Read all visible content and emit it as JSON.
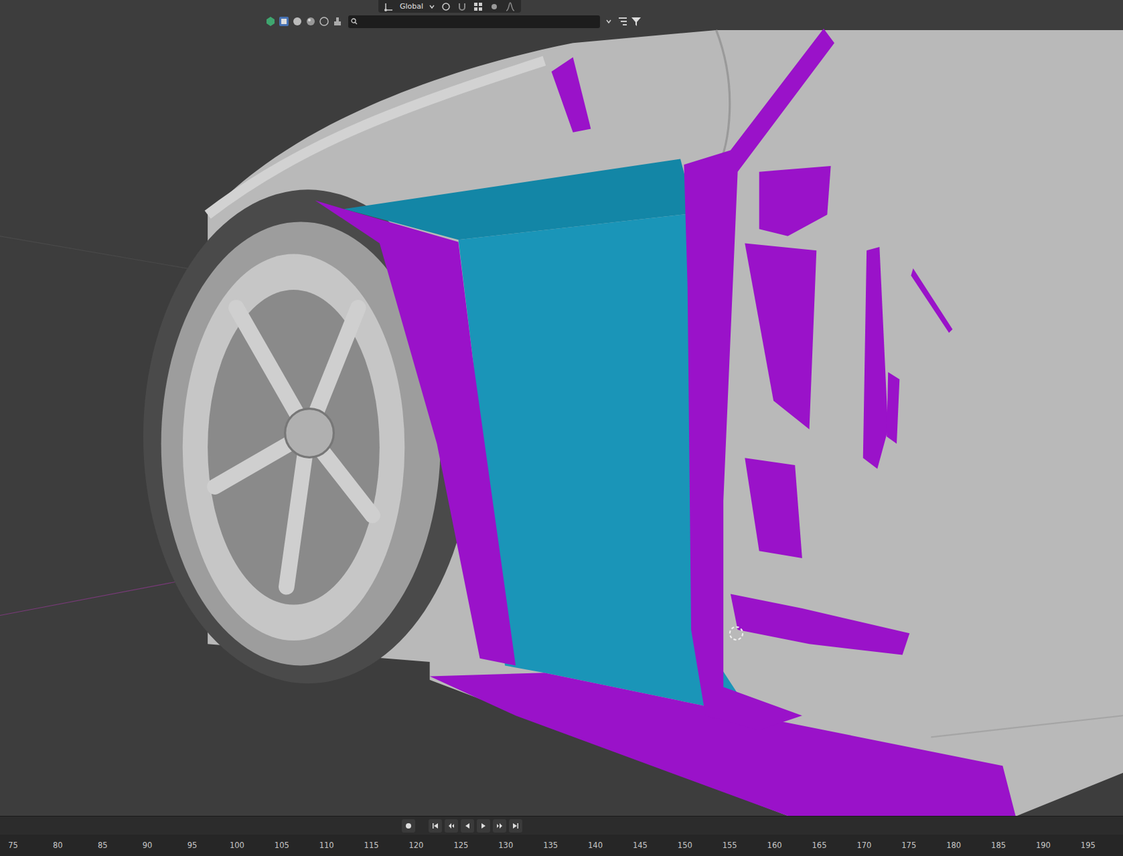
{
  "header": {
    "orientation": "Global",
    "search": {
      "value": ""
    }
  },
  "timeline": {
    "ruler": [
      "75",
      "80",
      "85",
      "90",
      "95",
      "100",
      "105",
      "110",
      "115",
      "120",
      "125",
      "130",
      "135",
      "140",
      "145",
      "150",
      "155",
      "160",
      "165",
      "170",
      "175",
      "180",
      "185",
      "190",
      "195"
    ]
  }
}
